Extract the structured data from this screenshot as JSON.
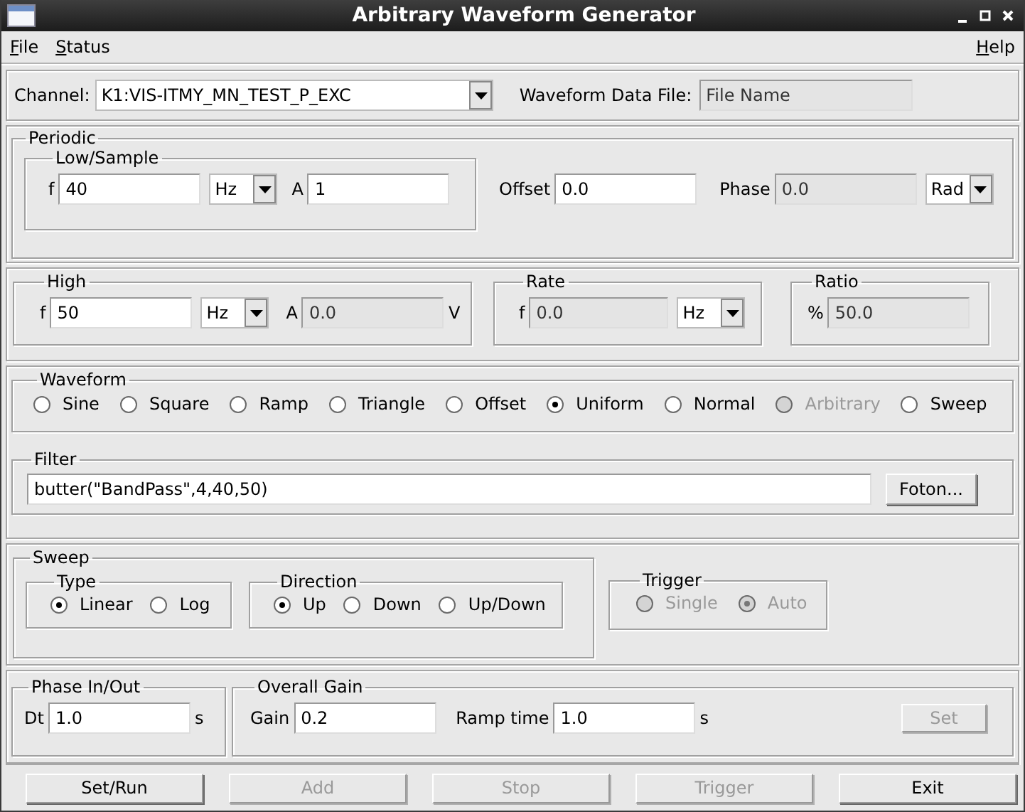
{
  "window": {
    "title": "Arbitrary Waveform Generator"
  },
  "menu": [
    {
      "label": "File"
    },
    {
      "label": "Status"
    },
    {
      "label": "Help"
    }
  ],
  "channel": {
    "label": "Channel:",
    "dropdown": "K1:VIS-ITMY_MN_TEST_P_EXC"
  },
  "waveform_file": {
    "label": "Waveform Data File:",
    "value": "File Name",
    "disabled": true
  },
  "periodic": {
    "title": "Periodic",
    "low_sample": {
      "title": "Low/Sample",
      "fields": [
        {
          "label": "f",
          "value": "40",
          "disabled": false,
          "dropdown": "Hz"
        },
        {
          "label": "A",
          "value": "1",
          "disabled": false
        }
      ]
    },
    "fields": [
      {
        "label": "Offset",
        "value": "0.0",
        "disabled": false
      },
      {
        "label": "Phase",
        "value": "0.0",
        "disabled": true,
        "dropdown": "Rad"
      }
    ]
  },
  "high": {
    "title": "High",
    "fields": [
      {
        "label": "f",
        "value": "50",
        "disabled": false,
        "dropdown": "Hz"
      },
      {
        "label": "A",
        "value": "0.0",
        "disabled": true,
        "unit": "V"
      }
    ]
  },
  "rate": {
    "title": "Rate",
    "fields": [
      {
        "label": "f",
        "value": "0.0",
        "disabled": true,
        "dropdown": "Hz"
      }
    ]
  },
  "ratio": {
    "title": "Ratio",
    "fields": [
      {
        "label": "%",
        "value": "50.0",
        "disabled": true
      }
    ]
  },
  "waveform": {
    "title": "Waveform",
    "options": [
      {
        "label": "Sine",
        "selected": false,
        "disabled": false
      },
      {
        "label": "Square",
        "selected": false,
        "disabled": false
      },
      {
        "label": "Ramp",
        "selected": false,
        "disabled": false
      },
      {
        "label": "Triangle",
        "selected": false,
        "disabled": false
      },
      {
        "label": "Offset",
        "selected": false,
        "disabled": false
      },
      {
        "label": "Uniform",
        "selected": true,
        "disabled": false
      },
      {
        "label": "Normal",
        "selected": false,
        "disabled": false
      },
      {
        "label": "Arbitrary",
        "selected": false,
        "disabled": true
      },
      {
        "label": "Sweep",
        "selected": false,
        "disabled": false
      }
    ]
  },
  "filter": {
    "title": "Filter",
    "value": "butter(\"BandPass\",4,40,50)",
    "button": {
      "label": "Foton...",
      "disabled": false
    }
  },
  "sweep": {
    "title": "Sweep",
    "type": {
      "title": "Type",
      "options": [
        {
          "label": "Linear",
          "selected": true
        },
        {
          "label": "Log",
          "selected": false
        }
      ]
    },
    "direction": {
      "title": "Direction",
      "options": [
        {
          "label": "Up",
          "selected": true
        },
        {
          "label": "Down",
          "selected": false
        },
        {
          "label": "Up/Down",
          "selected": false
        }
      ]
    }
  },
  "trigger": {
    "title": "Trigger",
    "options": [
      {
        "label": "Single",
        "selected": false,
        "disabled": true
      },
      {
        "label": "Auto",
        "selected": true,
        "disabled": true
      }
    ]
  },
  "phase_in_out": {
    "title": "Phase In/Out",
    "fields": [
      {
        "label": "Dt",
        "value": "1.0",
        "disabled": false,
        "unit": "s"
      }
    ]
  },
  "overall_gain": {
    "title": "Overall Gain",
    "fields": [
      {
        "label": "Gain",
        "value": "0.2",
        "disabled": false
      },
      {
        "label": "Ramp time",
        "value": "1.0",
        "disabled": false,
        "unit": "s"
      }
    ],
    "button": {
      "label": "Set",
      "disabled": true
    }
  },
  "buttons": [
    {
      "label": "Set/Run",
      "disabled": false
    },
    {
      "label": "Add",
      "disabled": true
    },
    {
      "label": "Stop",
      "disabled": true
    },
    {
      "label": "Trigger",
      "disabled": true
    },
    {
      "label": "Exit",
      "disabled": false
    }
  ]
}
